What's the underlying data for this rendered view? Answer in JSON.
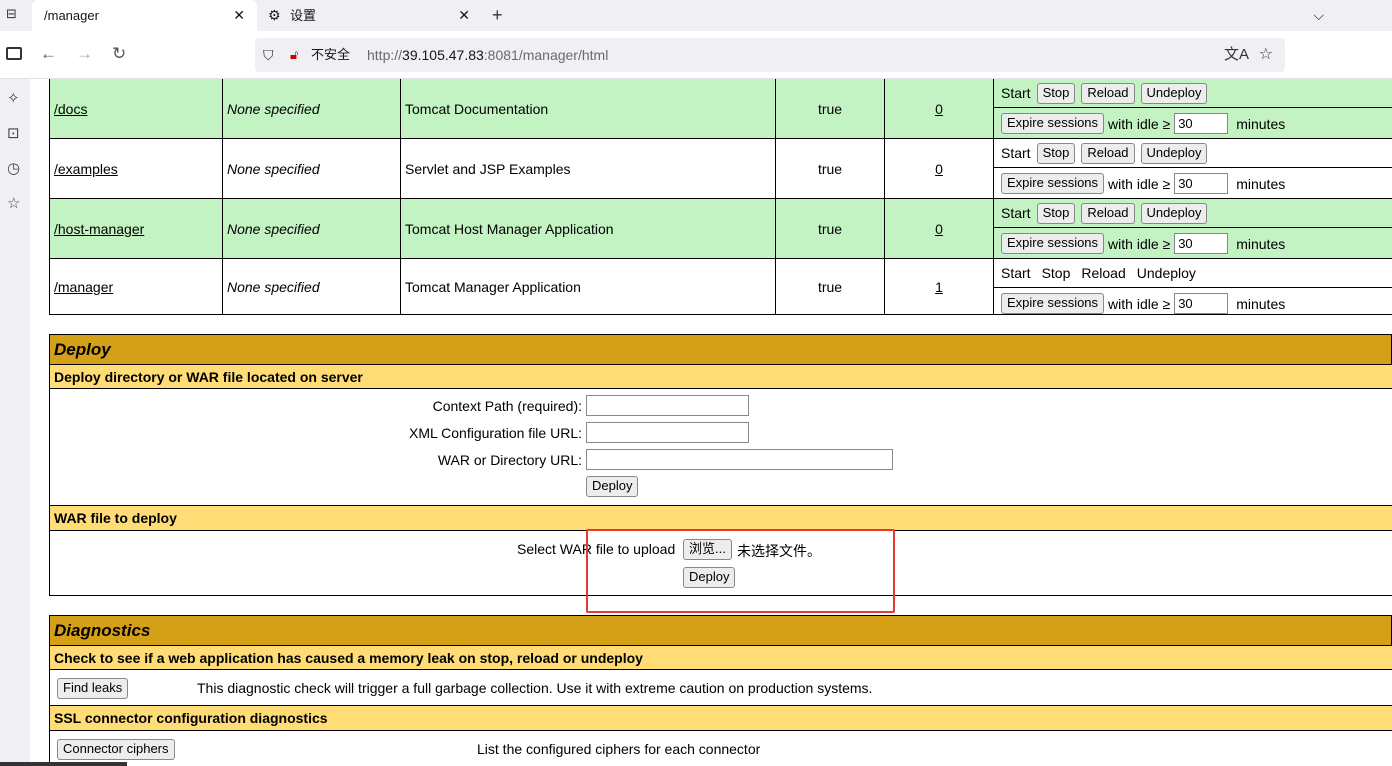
{
  "browser": {
    "tabs": [
      {
        "title": "/manager",
        "active": true
      },
      {
        "title": "设置",
        "active": false
      }
    ],
    "url": {
      "security_label": "不安全",
      "prefix": "http://",
      "host": "39.105.47.83",
      "rest": ":8081/manager/html"
    }
  },
  "apps": [
    {
      "path": "/docs",
      "version": "None specified",
      "display_name": "Tomcat Documentation",
      "running": "true",
      "sessions": "0",
      "style": "green",
      "commands_as_buttons": true
    },
    {
      "path": "/examples",
      "version": "None specified",
      "display_name": "Servlet and JSP Examples",
      "running": "true",
      "sessions": "0",
      "style": "white",
      "commands_as_buttons": true
    },
    {
      "path": "/host-manager",
      "version": "None specified",
      "display_name": "Tomcat Host Manager Application",
      "running": "true",
      "sessions": "0",
      "style": "green",
      "commands_as_buttons": true
    },
    {
      "path": "/manager",
      "version": "None specified",
      "display_name": "Tomcat Manager Application",
      "running": "true",
      "sessions": "1",
      "style": "white",
      "commands_as_buttons": false
    }
  ],
  "commands": {
    "start": "Start",
    "stop": "Stop",
    "reload": "Reload",
    "undeploy": "Undeploy",
    "expire": "Expire sessions",
    "with_idle": "with idle ≥",
    "idle_value": "30",
    "minutes": "minutes"
  },
  "deploy": {
    "title": "Deploy",
    "server_section": "Deploy directory or WAR file located on server",
    "context_path_label": "Context Path (required):",
    "xml_config_label": "XML Configuration file URL:",
    "war_dir_label": "WAR or Directory URL:",
    "deploy_button": "Deploy",
    "war_section": "WAR file to deploy",
    "select_war_label": "Select WAR file to upload",
    "browse_button": "浏览...",
    "no_file_text": "未选择文件。",
    "upload_deploy_button": "Deploy"
  },
  "diagnostics": {
    "title": "Diagnostics",
    "leak_section": "Check to see if a web application has caused a memory leak on stop, reload or undeploy",
    "find_leaks_button": "Find leaks",
    "find_leaks_text": "This diagnostic check will trigger a full garbage collection. Use it with extreme caution on production systems.",
    "ssl_section": "SSL connector configuration diagnostics",
    "connector_ciphers_button": "Connector ciphers",
    "connector_ciphers_text": "List the configured ciphers for each connector"
  },
  "colors": {
    "row_green": "#c3f3c3",
    "section_gold": "#d4a017",
    "subsection_yellow": "#ffdc75",
    "highlight_red": "#e53935"
  }
}
